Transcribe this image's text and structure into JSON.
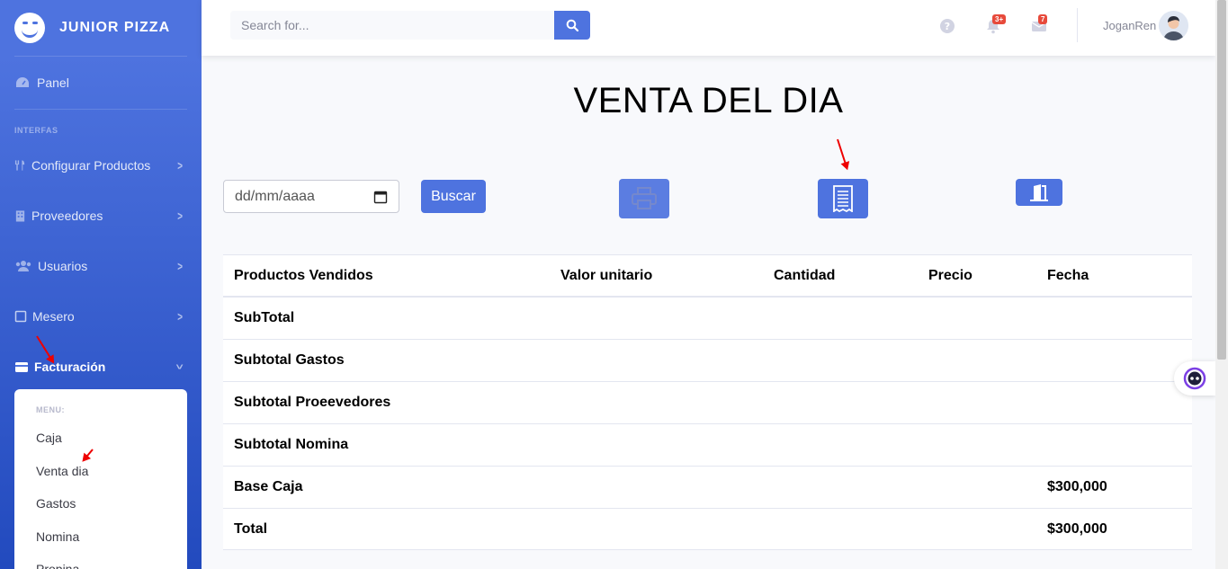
{
  "brand": {
    "name": "JUNIOR PIZZA"
  },
  "sidebar": {
    "panel": "Panel",
    "heading": "INTERFAS",
    "items": [
      {
        "label": "Configurar Productos",
        "icon": "utensils-icon"
      },
      {
        "label": "Proveedores",
        "icon": "building-icon"
      },
      {
        "label": "Usuarios",
        "icon": "users-icon"
      },
      {
        "label": "Mesero",
        "icon": "tablet-icon"
      },
      {
        "label": "Facturación",
        "icon": "wallet-icon"
      }
    ],
    "submenu": {
      "heading": "MENU:",
      "items": [
        "Caja",
        "Venta dia",
        "Gastos",
        "Nomina",
        "Propina"
      ]
    }
  },
  "topbar": {
    "search_placeholder": "Search for...",
    "alerts_badge": "3+",
    "messages_badge": "7",
    "username": "JoganRen"
  },
  "main": {
    "title": "VENTA DEL DIA",
    "date_placeholder": "dd/mm/aaaa",
    "search_button": "Buscar",
    "table": {
      "headers": [
        "Productos Vendidos",
        "Valor unitario",
        "Cantidad",
        "Precio",
        "Fecha"
      ],
      "rows": [
        {
          "label": "SubTotal",
          "value": ""
        },
        {
          "label": "Subtotal Gastos",
          "value": ""
        },
        {
          "label": "Subtotal Proeevedores",
          "value": ""
        },
        {
          "label": "Subtotal Nomina",
          "value": ""
        },
        {
          "label": "Base Caja",
          "value": "$300,000"
        },
        {
          "label": "Total",
          "value": "$300,000"
        }
      ]
    }
  },
  "colors": {
    "primary": "#4e73df",
    "danger": "#e74a3b",
    "annotation_arrow": "#ee0000"
  }
}
